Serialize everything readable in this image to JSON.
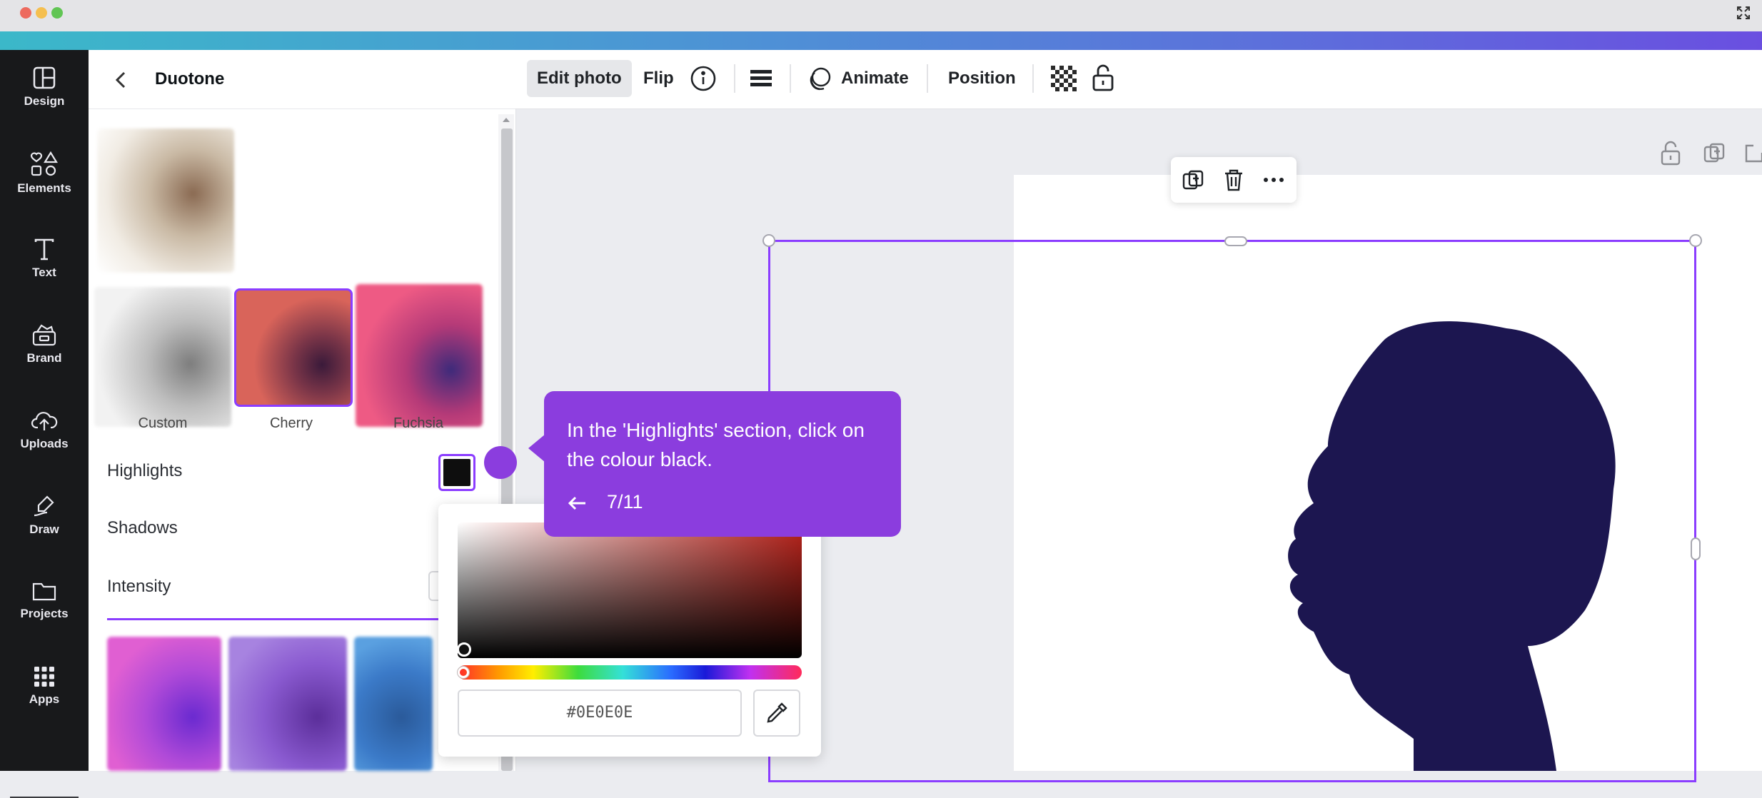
{
  "window": {
    "traffic_lights": [
      "#ed6a5e",
      "#f5bf4f",
      "#61c554"
    ]
  },
  "rail": {
    "items": [
      {
        "label": "Design",
        "icon": "layout-icon"
      },
      {
        "label": "Elements",
        "icon": "shapes-icon"
      },
      {
        "label": "Text",
        "icon": "text-icon"
      },
      {
        "label": "Brand",
        "icon": "brand-kit-icon"
      },
      {
        "label": "Uploads",
        "icon": "cloud-upload-icon"
      },
      {
        "label": "Draw",
        "icon": "draw-icon"
      },
      {
        "label": "Projects",
        "icon": "folder-icon"
      },
      {
        "label": "Apps",
        "icon": "apps-grid-icon"
      }
    ]
  },
  "panel": {
    "title": "Duotone",
    "presets": [
      {
        "label": "Custom"
      },
      {
        "label": "Cherry",
        "selected": true
      },
      {
        "label": "Fuchsia"
      }
    ],
    "highlights_label": "Highlights",
    "highlights_color": "#0E0E0E",
    "shadows_label": "Shadows",
    "intensity_label": "Intensity"
  },
  "toolbar": {
    "edit_photo": "Edit photo",
    "flip": "Flip",
    "animate": "Animate",
    "position": "Position"
  },
  "color_picker": {
    "hex_value": "#0E0E0E"
  },
  "tooltip": {
    "text": "In the 'Highlights' section, click on the colour black.",
    "step": "7/11"
  },
  "accent_color": "#8b3dff",
  "tooltip_color": "#8b3dde",
  "silhouette_color": "#1c1650"
}
